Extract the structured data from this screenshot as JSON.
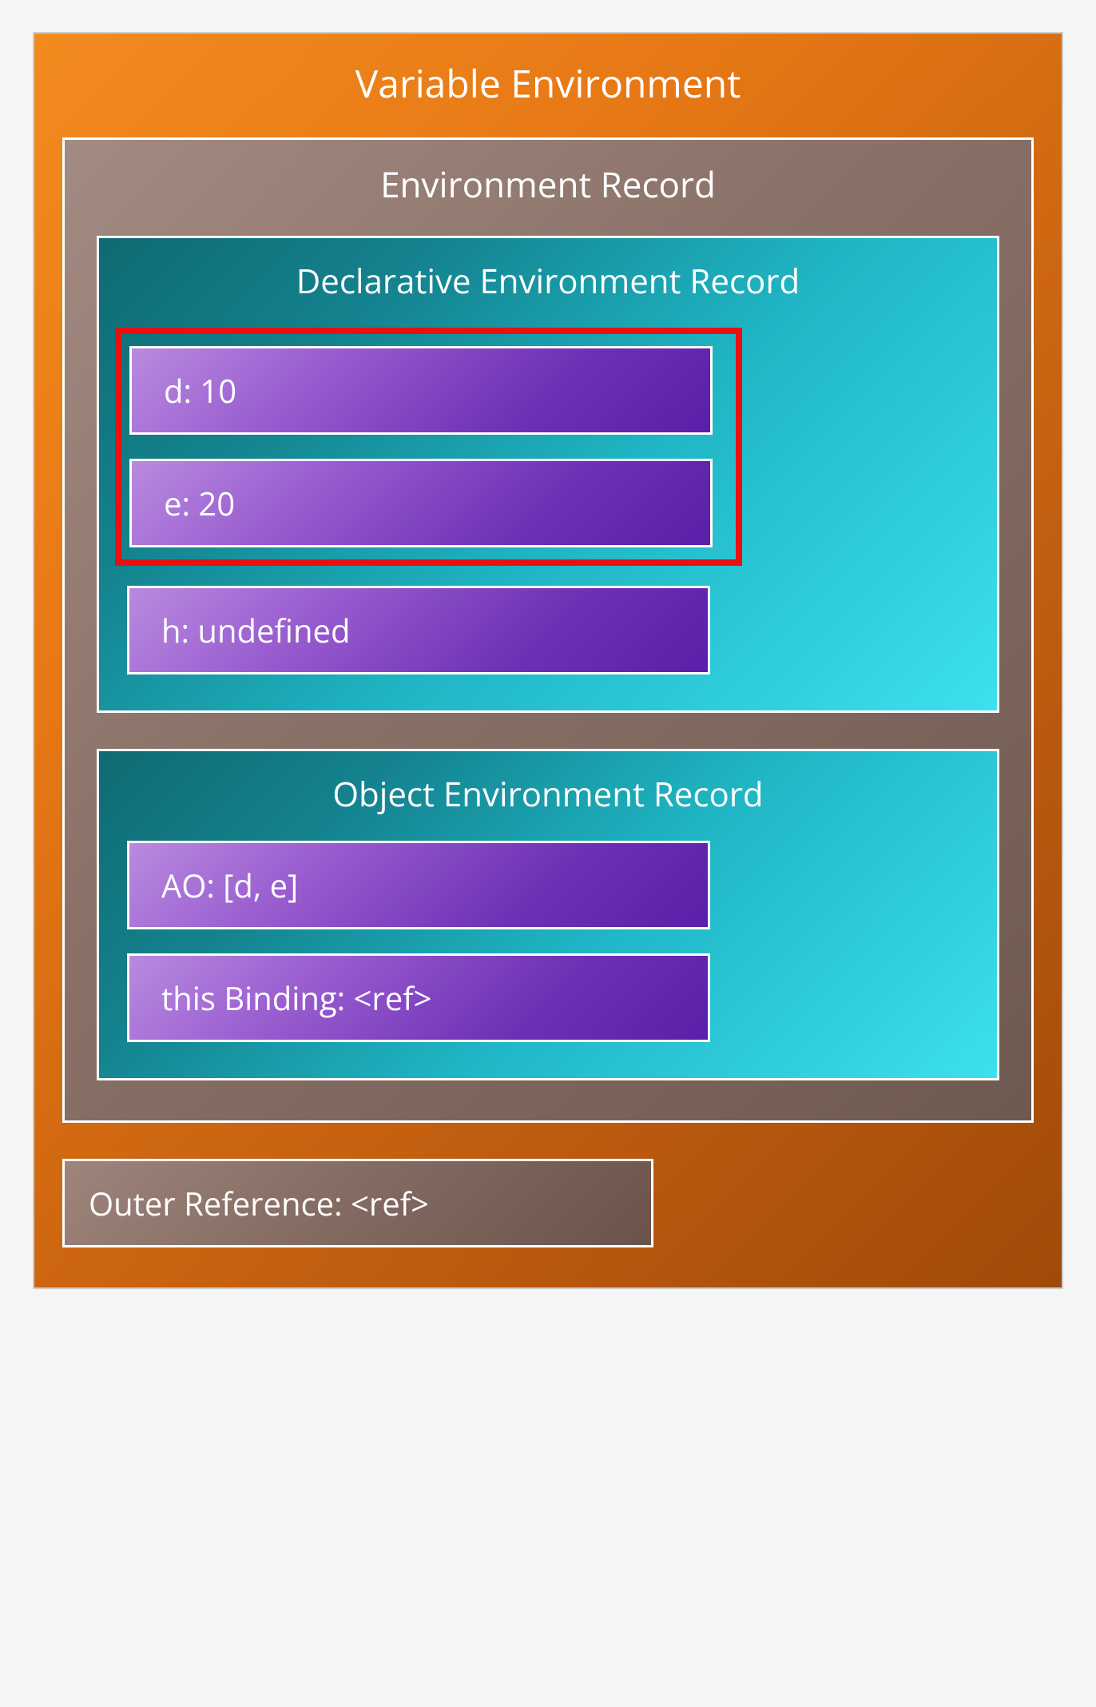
{
  "variableEnvironment": {
    "title": "Variable Environment",
    "environmentRecord": {
      "title": "Environment Record",
      "declarative": {
        "title": "Declarative Environment Record",
        "highlighted": [
          "d: 10",
          "e: 20"
        ],
        "other": [
          "h: undefined"
        ]
      },
      "object": {
        "title": "Object Environment Record",
        "items": [
          "AO: [d, e]",
          "this Binding: <ref>"
        ]
      }
    },
    "outerReference": "Outer Reference: <ref>"
  }
}
